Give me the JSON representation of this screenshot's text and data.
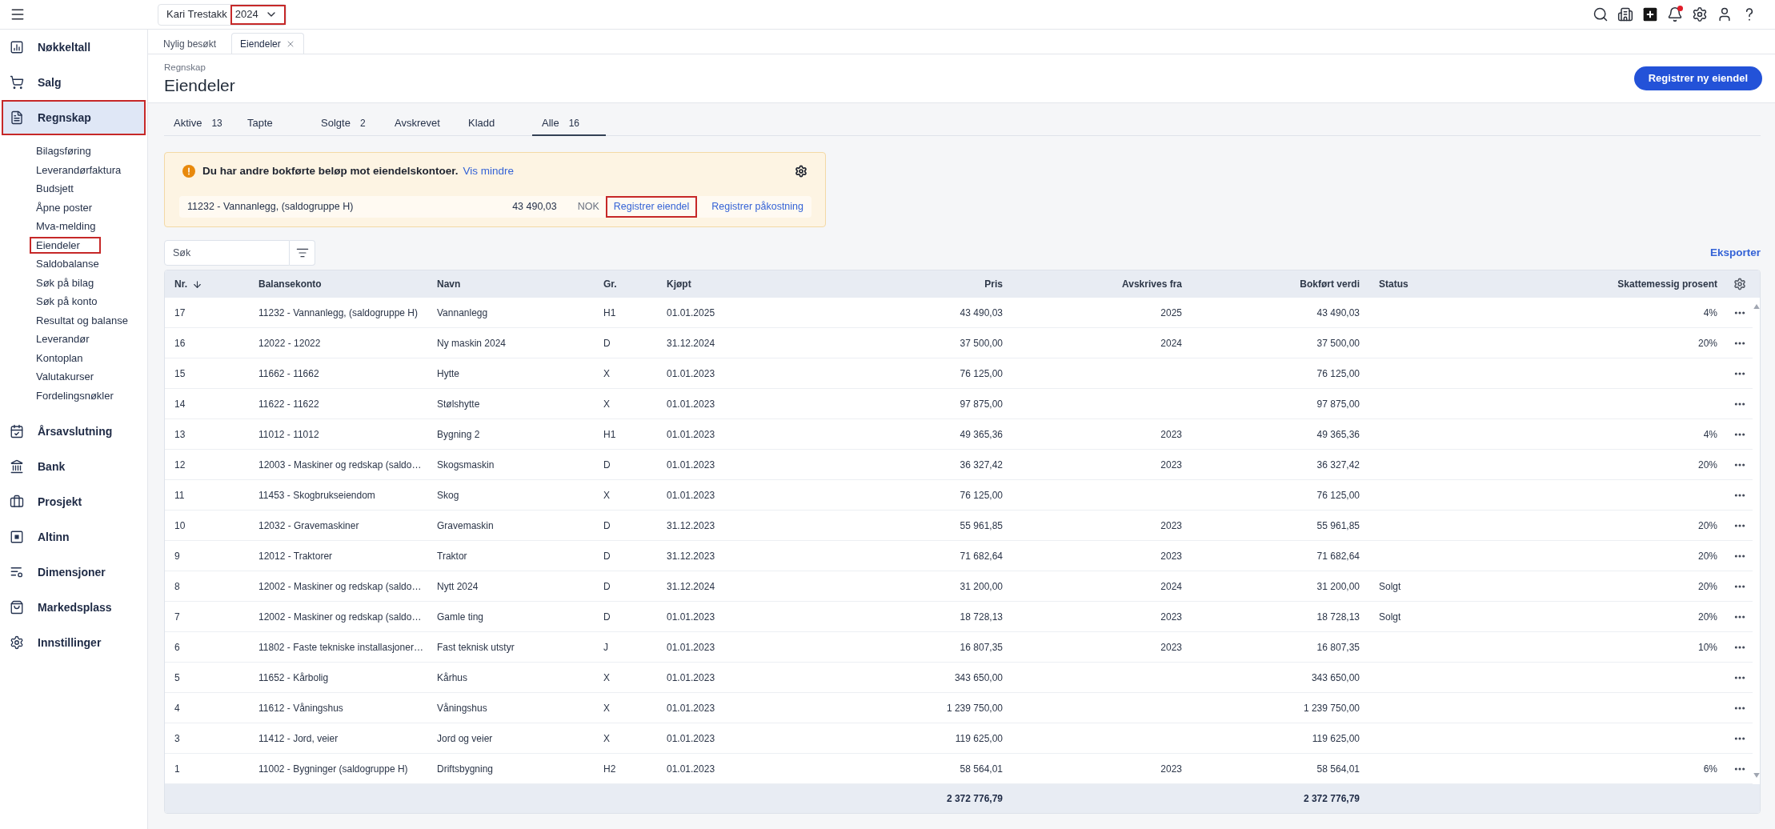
{
  "topbar": {
    "company": "Kari Trestakk",
    "year": "2024",
    "year_highlighted": true,
    "unread_notifications": true
  },
  "sidebar": {
    "items": [
      {
        "label": "Nøkkeltall",
        "selected": false,
        "highlighted": false
      },
      {
        "label": "Salg",
        "selected": false,
        "highlighted": false
      },
      {
        "label": "Regnskap",
        "selected": true,
        "highlighted": true,
        "children": [
          {
            "label": "Bilagsføring",
            "highlighted": false
          },
          {
            "label": "Leverandørfaktura",
            "highlighted": false
          },
          {
            "label": "Budsjett",
            "highlighted": false
          },
          {
            "label": "Åpne poster",
            "highlighted": false
          },
          {
            "label": "Mva-melding",
            "highlighted": false
          },
          {
            "label": "Eiendeler",
            "highlighted": true
          },
          {
            "label": "Saldobalanse",
            "highlighted": false
          },
          {
            "label": "Søk på bilag",
            "highlighted": false
          },
          {
            "label": "Søk på konto",
            "highlighted": false
          },
          {
            "label": "Resultat og balanse",
            "highlighted": false
          },
          {
            "label": "Leverandør",
            "highlighted": false
          },
          {
            "label": "Kontoplan",
            "highlighted": false
          },
          {
            "label": "Valutakurser",
            "highlighted": false
          },
          {
            "label": "Fordelingsnøkler",
            "highlighted": false
          }
        ]
      },
      {
        "label": "Årsavslutning",
        "selected": false,
        "highlighted": false
      },
      {
        "label": "Bank",
        "selected": false,
        "highlighted": false
      },
      {
        "label": "Prosjekt",
        "selected": false,
        "highlighted": false
      },
      {
        "label": "Altinn",
        "selected": false,
        "highlighted": false
      },
      {
        "label": "Dimensjoner",
        "selected": false,
        "highlighted": false
      },
      {
        "label": "Markedsplass",
        "selected": false,
        "highlighted": false
      },
      {
        "label": "Innstillinger",
        "selected": false,
        "highlighted": false
      }
    ]
  },
  "open_tabs": [
    {
      "label": "Nylig besøkt",
      "selected": false,
      "closable": false
    },
    {
      "label": "Eiendeler",
      "selected": true,
      "closable": true
    }
  ],
  "header": {
    "breadcrumb": "Regnskap",
    "title": "Eiendeler",
    "primary_button": "Registrer ny eiendel"
  },
  "filter_tabs": [
    {
      "label": "Aktive",
      "count": "13",
      "selected": false
    },
    {
      "label": "Tapte",
      "selected": false
    },
    {
      "label": "Solgte",
      "count": "2",
      "selected": false
    },
    {
      "label": "Avskrevet",
      "selected": false
    },
    {
      "label": "Kladd",
      "selected": false
    },
    {
      "label": "Alle",
      "count": "16",
      "selected": true
    }
  ],
  "notice": {
    "message": "Du har andre bokførte beløp mot eiendelskontoer.",
    "toggle_link": "Vis mindre",
    "rows": [
      {
        "account": "11232 - Vannanlegg, (saldogruppe H)",
        "amount": "43 490,03",
        "currency": "NOK",
        "actions": [
          {
            "label": "Registrer eiendel",
            "highlighted": true
          },
          {
            "label": "Registrer påkostning",
            "highlighted": false
          }
        ]
      }
    ]
  },
  "search": {
    "placeholder": "Søk"
  },
  "export_link": "Eksporter",
  "table": {
    "columns": [
      {
        "label": "Nr.",
        "sorted": true
      },
      {
        "label": "Balansekonto",
        "sorted": false
      },
      {
        "label": "Navn",
        "sorted": false
      },
      {
        "label": "Gr.",
        "sorted": false
      },
      {
        "label": "Kjøpt",
        "sorted": false
      },
      {
        "label": "Pris",
        "sorted": false
      },
      {
        "label": "Avskrives fra",
        "sorted": false
      },
      {
        "label": "Bokført verdi",
        "sorted": false
      },
      {
        "label": "Status",
        "sorted": false
      },
      {
        "label": "Skattemessig prosent",
        "sorted": false
      }
    ],
    "rows": [
      {
        "nr": "17",
        "account": "11232 - Vannanlegg, (saldogruppe H)",
        "name": "Vannanlegg",
        "group": "H1",
        "purchased": "01.01.2025",
        "price": "43 490,03",
        "depreciation_from": "2025",
        "book_value": "43 490,03",
        "tax_percent": "4%"
      },
      {
        "nr": "16",
        "account": "12022 - 12022",
        "name": "Ny maskin 2024",
        "group": "D",
        "purchased": "31.12.2024",
        "price": "37 500,00",
        "depreciation_from": "2024",
        "book_value": "37 500,00",
        "tax_percent": "20%"
      },
      {
        "nr": "15",
        "account": "11662 - 11662",
        "name": "Hytte",
        "group": "X",
        "purchased": "01.01.2023",
        "price": "76 125,00",
        "book_value": "76 125,00"
      },
      {
        "nr": "14",
        "account": "11622 - 11622",
        "name": "Stølshytte",
        "group": "X",
        "purchased": "01.01.2023",
        "price": "97 875,00",
        "book_value": "97 875,00"
      },
      {
        "nr": "13",
        "account": "11012 - 11012",
        "name": "Bygning 2",
        "group": "H1",
        "purchased": "01.01.2023",
        "price": "49 365,36",
        "depreciation_from": "2023",
        "book_value": "49 365,36",
        "tax_percent": "4%"
      },
      {
        "nr": "12",
        "account": "12003 - Maskiner og redskap (saldo…",
        "name": "Skogsmaskin",
        "group": "D",
        "purchased": "01.01.2023",
        "price": "36 327,42",
        "depreciation_from": "2023",
        "book_value": "36 327,42",
        "tax_percent": "20%"
      },
      {
        "nr": "11",
        "account": "11453 - Skogbrukseiendom",
        "name": "Skog",
        "group": "X",
        "purchased": "01.01.2023",
        "price": "76 125,00",
        "book_value": "76 125,00"
      },
      {
        "nr": "10",
        "account": "12032 - Gravemaskiner",
        "name": "Gravemaskin",
        "group": "D",
        "purchased": "31.12.2023",
        "price": "55 961,85",
        "depreciation_from": "2023",
        "book_value": "55 961,85",
        "tax_percent": "20%"
      },
      {
        "nr": "9",
        "account": "12012 - Traktorer",
        "name": "Traktor",
        "group": "D",
        "purchased": "31.12.2023",
        "price": "71 682,64",
        "depreciation_from": "2023",
        "book_value": "71 682,64",
        "tax_percent": "20%"
      },
      {
        "nr": "8",
        "account": "12002 - Maskiner og redskap (saldo…",
        "name": "Nytt 2024",
        "group": "D",
        "purchased": "31.12.2024",
        "price": "31 200,00",
        "depreciation_from": "2024",
        "book_value": "31 200,00",
        "status": "Solgt",
        "tax_percent": "20%"
      },
      {
        "nr": "7",
        "account": "12002 - Maskiner og redskap (saldo…",
        "name": "Gamle ting",
        "group": "D",
        "purchased": "01.01.2023",
        "price": "18 728,13",
        "depreciation_from": "2023",
        "book_value": "18 728,13",
        "status": "Solgt",
        "tax_percent": "20%"
      },
      {
        "nr": "6",
        "account": "11802 - Faste tekniske installasjoner…",
        "name": "Fast teknisk utstyr",
        "group": "J",
        "purchased": "01.01.2023",
        "price": "16 807,35",
        "depreciation_from": "2023",
        "book_value": "16 807,35",
        "tax_percent": "10%"
      },
      {
        "nr": "5",
        "account": "11652 - Kårbolig",
        "name": "Kårhus",
        "group": "X",
        "purchased": "01.01.2023",
        "price": "343 650,00",
        "book_value": "343 650,00"
      },
      {
        "nr": "4",
        "account": "11612 - Våningshus",
        "name": "Våningshus",
        "group": "X",
        "purchased": "01.01.2023",
        "price": "1 239 750,00",
        "book_value": "1 239 750,00"
      },
      {
        "nr": "3",
        "account": "11412 - Jord, veier",
        "name": "Jord og veier",
        "group": "X",
        "purchased": "01.01.2023",
        "price": "119 625,00",
        "book_value": "119 625,00"
      },
      {
        "nr": "1",
        "account": "11002 - Bygninger (saldogruppe H)",
        "name": "Driftsbygning",
        "group": "H2",
        "purchased": "01.01.2023",
        "price": "58 564,01",
        "depreciation_from": "2023",
        "book_value": "58 564,01",
        "tax_percent": "6%"
      }
    ],
    "totals": {
      "price": "2 372 776,79",
      "book_value": "2 372 776,79"
    }
  }
}
